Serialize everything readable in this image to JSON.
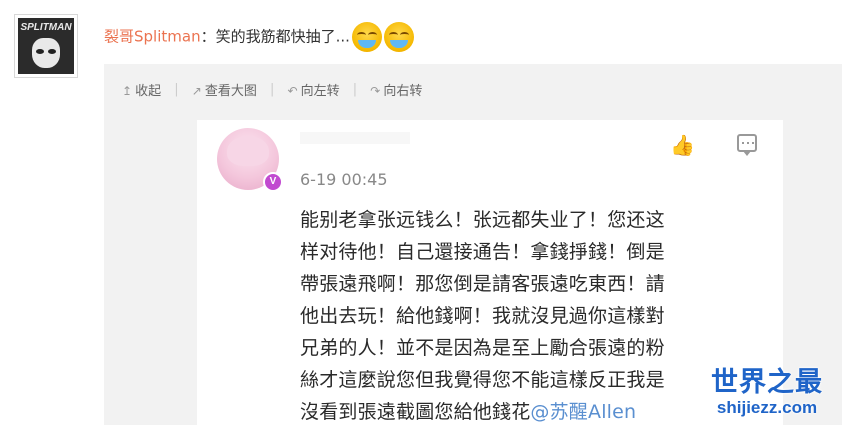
{
  "comment": {
    "author": "裂哥Splitman",
    "separator": "：",
    "text": "笑的我筋都快抽了...",
    "emojis": [
      "laugh-cry-emoji",
      "laugh-cry-emoji"
    ]
  },
  "avatar": {
    "logo_text": "SPLITMAN"
  },
  "toolbar": {
    "items": [
      {
        "icon": "collapse-icon",
        "label": "收起"
      },
      {
        "icon": "view-large-icon",
        "label": "查看大图"
      },
      {
        "icon": "rotate-left-icon",
        "label": "向左转"
      },
      {
        "icon": "rotate-right-icon",
        "label": "向右转"
      }
    ],
    "separator": "|"
  },
  "screenshot": {
    "vip_badge": "V",
    "time": "6-19 00:45",
    "lines": [
      "能别老拿张远钱么！张远都失业了！您还这",
      "样对待他！自己還接通告！拿錢掙錢！倒是",
      "帶張遠飛啊！那您倒是請客張遠吃東西！請",
      "他出去玩！給他錢啊！我就沒見過你這樣對",
      "兄弟的人！並不是因為是至上勵合張遠的粉",
      "絲才這麼說您但我覺得您不能這樣反正我是",
      "沒看到張遠截圖您給他錢花"
    ],
    "mention": "@苏醒Allen"
  },
  "watermark": {
    "title": "世界之最",
    "url": "shijiezz.com"
  },
  "colors": {
    "author": "#eb7350",
    "mention": "#5a8fd0",
    "watermark": "#1f64c8",
    "panel_bg": "#f2f2f2"
  }
}
